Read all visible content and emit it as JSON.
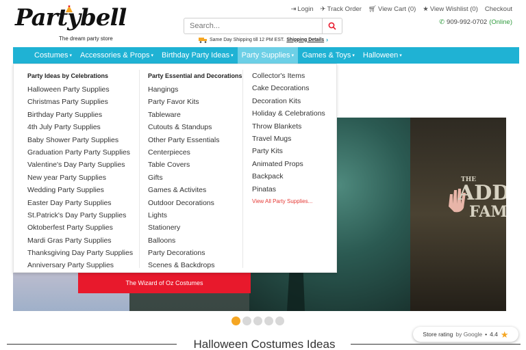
{
  "header": {
    "logo_text": "Partybell",
    "tagline": "The dream party store",
    "search_placeholder": "Search...",
    "shipping_text": "Same Day Shipping till 12 PM EST.",
    "shipping_link": "Shipping Details",
    "top_links": [
      {
        "label": "Login",
        "icon": "login-icon"
      },
      {
        "label": "Track Order",
        "icon": "track-icon"
      },
      {
        "label": "View Cart (0)",
        "icon": "cart-icon"
      },
      {
        "label": "View Wishlist (0)",
        "icon": "star-icon"
      },
      {
        "label": "Checkout",
        "icon": ""
      }
    ],
    "phone": "909-992-0702",
    "online": "(Online)"
  },
  "nav": {
    "items": [
      "Costumes",
      "Accessories & Props",
      "Birthday Party Ideas",
      "Party Supplies",
      "Games & Toys",
      "Halloween"
    ],
    "active_index": 3
  },
  "mega_menu": {
    "col1": {
      "title": "Party Ideas by Celebrations",
      "items": [
        "Halloween Party Supplies",
        "Christmas Party Supplies",
        "Birthday Party Supplies",
        "4th July Party Supplies",
        "Baby Shower Party Supplies",
        "Graduation Party Party Supplies",
        "Valentine's Day Party Supplies",
        "New year Party Supplies",
        "Wedding Party Supplies",
        "Easter Day Party Supplies",
        "St.Patrick's Day Party Supplies",
        "Oktoberfest Party Supplies",
        "Mardi Gras Party Supplies",
        "Thanksgiving Day Party Supplies",
        "Anniversary Party Supplies"
      ]
    },
    "col2": {
      "title": "Party Essential and Decorations",
      "items": [
        "Hangings",
        "Party Favor Kits",
        "Tableware",
        "Cutouts & Standups",
        "Other Party Essentials",
        "Centerpieces",
        "Table Covers",
        "Gifts",
        "Games & Activites",
        "Outdoor Decorations",
        "Lights",
        "Stationery",
        "Balloons",
        "Party Decorations",
        "Scenes & Backdrops"
      ]
    },
    "col3": {
      "items": [
        "Collector's Items",
        "Cake Decorations",
        "Decoration Kits",
        "Holiday & Celebrations",
        "Throw Blankets",
        "Travel Mugs",
        "Party Kits",
        "Animated Props",
        "Backpack",
        "Pinatas"
      ],
      "view_all": "View All Party Supplies..."
    }
  },
  "banner": {
    "oz_button": "The Wizard of Oz Costumes",
    "addams_the": "THE",
    "addams_big": "ADD",
    "addams_fam": "FAM",
    "slide_count": 5,
    "active_slide": 0
  },
  "section_title": "Halloween Costumes Ideas",
  "rating": {
    "label": "Store rating",
    "by": "by Google",
    "sep": "•",
    "value": "4.4"
  },
  "colors": {
    "nav_bg": "#1fb2d4",
    "nav_active": "#6ccfe6",
    "accent_red": "#e8192c",
    "online_green": "#2e9a3c",
    "dot_active": "#f5a623"
  }
}
